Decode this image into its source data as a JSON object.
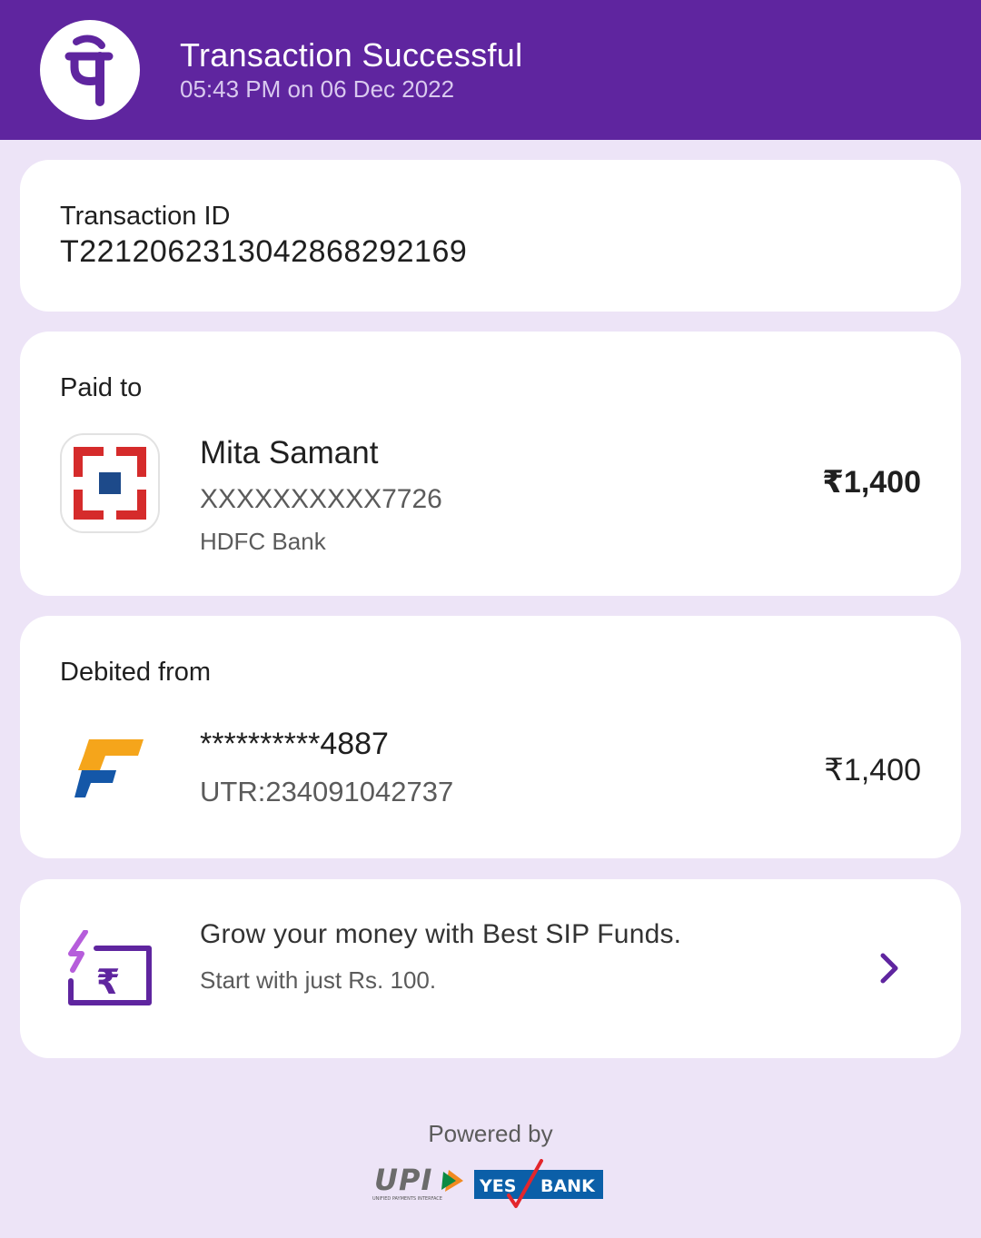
{
  "header": {
    "title": "Transaction Successful",
    "datetime": "05:43 PM on 06 Dec 2022",
    "logo_icon": "phonepe-logo-icon",
    "background": "#5f259f"
  },
  "transaction": {
    "label": "Transaction ID",
    "id": "T2212062313042868292169"
  },
  "paid_to": {
    "label": "Paid to",
    "name": "Mita Samant",
    "account": "XXXXXXXXXX7726",
    "bank": "HDFC Bank",
    "amount": "₹1,400",
    "bank_icon": "hdfc-bank-logo-icon"
  },
  "debited_from": {
    "label": "Debited from",
    "account": "**********4887",
    "utr": "UTR:234091042737",
    "amount": "₹1,400",
    "bank_icon": "federal-bank-logo-icon"
  },
  "promo": {
    "title": "Grow your money with Best SIP Funds.",
    "subtitle": "Start with just Rs. 100.",
    "icon": "sip-rupee-icon",
    "chevron_icon": "chevron-right-icon"
  },
  "footer": {
    "powered_by": "Powered by",
    "upi_text": "UPI",
    "upi_tagline": "UNIFIED PAYMENTS INTERFACE",
    "bank_yes": "YES",
    "bank_name": "BANK"
  },
  "colors": {
    "accent": "#5f259f",
    "page_bg": "#ede4f7",
    "hdfc_red": "#d52b2b",
    "hdfc_blue": "#1d4a8a",
    "yes_blue": "#0b5fa8"
  }
}
